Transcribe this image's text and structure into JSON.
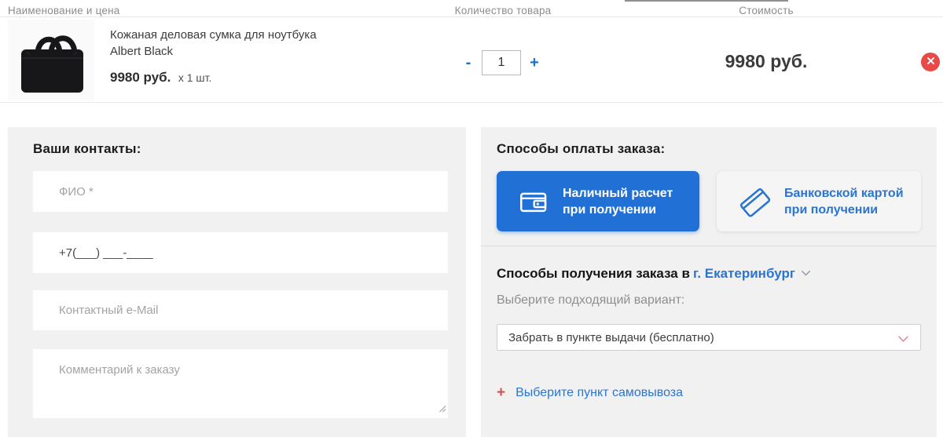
{
  "cart": {
    "headers": {
      "name_price": "Наименование и цена",
      "quantity": "Количество товара",
      "cost": "Стоимость"
    },
    "item": {
      "title": "Кожаная деловая сумка для ноутбука",
      "subtitle": "Albert Black",
      "unit_price": "9980 руб.",
      "unit_qty": "х 1 шт.",
      "quantity": "1",
      "minus_label": "-",
      "plus_label": "+",
      "total": "9980 руб."
    }
  },
  "contacts": {
    "title": "Ваши контакты:",
    "name_placeholder": "ФИО *",
    "phone_value": "+7(___) ___-____",
    "email_placeholder": "Контактный e-Mail",
    "comment_placeholder": "Комментарий к заказу"
  },
  "payment": {
    "title": "Способы оплаты заказа:",
    "cash": {
      "line1": "Наличный расчет",
      "line2": "при получении"
    },
    "card": {
      "line1": "Банковской картой",
      "line2": "при получении"
    }
  },
  "delivery": {
    "title": "Способы получения заказа в",
    "city": "г. Екатеринбург",
    "variant_label": "Выберите подходящий вариант:",
    "selected_variant": "Забрать в пункте выдачи (бесплатно)",
    "pickup_plus": "+",
    "pickup_link": "Выберите пункт самовывоза"
  },
  "colors": {
    "accent_blue": "#2170d6",
    "link_blue": "#2b75cf",
    "danger_red": "#e94a47",
    "rose_red": "#d4524e",
    "panel_gray": "#f1f1f1"
  }
}
